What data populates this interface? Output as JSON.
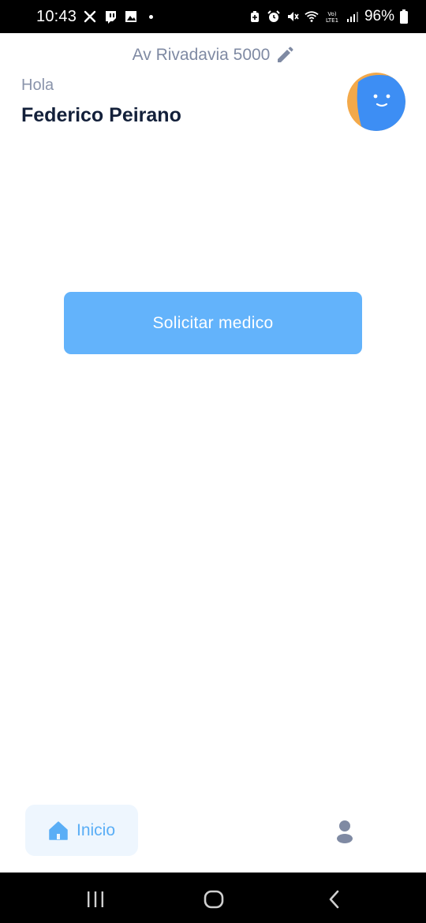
{
  "status_bar": {
    "time": "10:43",
    "battery": "96%",
    "left_icons": [
      "x-icon",
      "twitch-icon",
      "picture-icon"
    ],
    "right_icons": [
      "battery-saver-icon",
      "alarm-icon",
      "mute-icon",
      "wifi-icon",
      "volte-icon",
      "signal-icon",
      "battery-icon"
    ]
  },
  "header": {
    "address": "Av Rivadavia 5000",
    "greeting": "Hola",
    "user_name": "Federico Peirano",
    "avatar_colors": {
      "primary": "#3d8ef4",
      "secondary": "#f3a94a"
    }
  },
  "main": {
    "request_button_label": "Solicitar medico",
    "accent_color": "#63b3fb"
  },
  "bottom_nav": {
    "items": [
      {
        "label": "Inicio",
        "icon": "home-icon",
        "active": true
      },
      {
        "label": "",
        "icon": "user-icon",
        "active": false
      }
    ]
  },
  "system_nav": {
    "buttons": [
      "recents-icon",
      "home-circle-icon",
      "back-icon"
    ]
  }
}
